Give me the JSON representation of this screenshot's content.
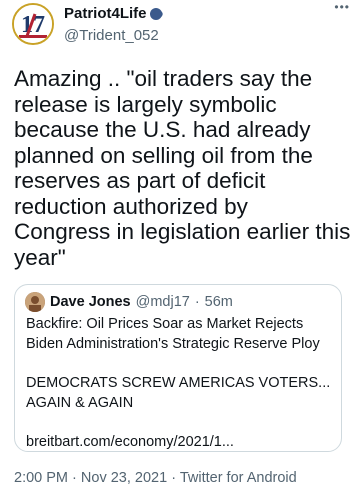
{
  "author": {
    "display_name": "Patriot4Life",
    "handle": "@Trident_052",
    "avatar_icon": "seventeen-logo",
    "verified_icon": "speaking-head-emoji"
  },
  "more_icon": "more-options",
  "tweet": {
    "lines": [
      "Amazing .. \"oil traders say the",
      "release is largely symbolic",
      "because the U.S. had already",
      "planned on selling oil from the",
      "reserves as part of deficit",
      "reduction authorized by",
      "Congress in legislation earlier this",
      "year\""
    ]
  },
  "quoted": {
    "display_name": "Dave Jones",
    "handle": "@mdj17",
    "separator": "·",
    "time": "56m",
    "headline_1": "Backfire: Oil Prices Soar as Market Rejects",
    "headline_2": "Biden Administration's Strategic Reserve Ploy",
    "comment_1": "DEMOCRATS SCREW AMERICAS VOTERS...",
    "comment_2": "AGAIN & AGAIN",
    "link": "breitbart.com/economy/2021/1..."
  },
  "footer": {
    "time": "2:00 PM",
    "date": "Nov 23, 2021",
    "source": "Twitter for Android",
    "separator": "·"
  }
}
